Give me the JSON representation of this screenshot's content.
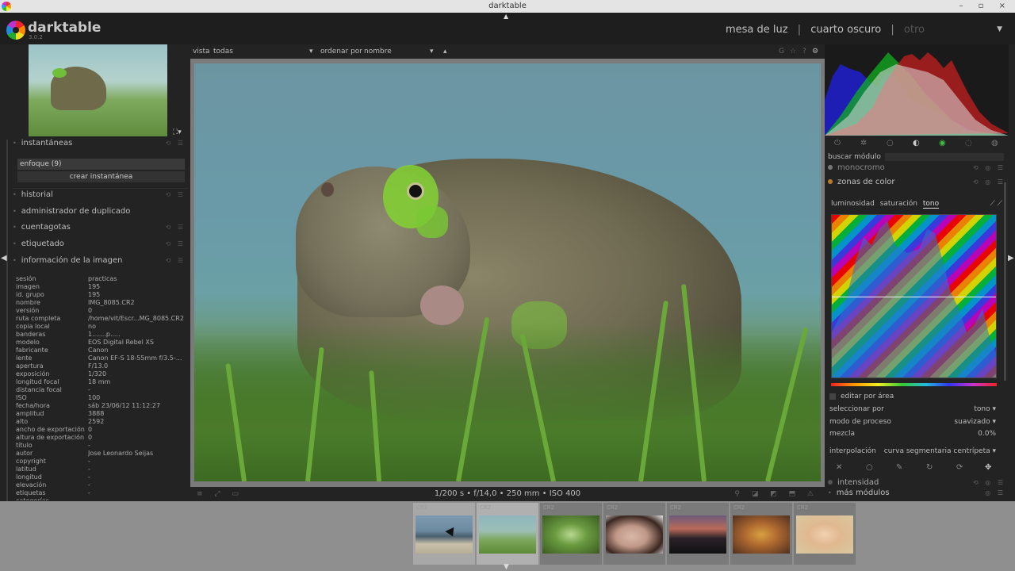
{
  "window": {
    "title": "darktable",
    "controls": "– ▫ ×"
  },
  "header": {
    "logo_text": "darktable",
    "version": "3.0.2",
    "views": [
      "mesa de luz",
      "cuarto oscuro",
      "otro"
    ],
    "separator": "|"
  },
  "toolbar": {
    "view_label": "vista",
    "view_value": "todas",
    "sort_label": "ordenar por",
    "sort_value": "nombre",
    "sort_arrow": "▴"
  },
  "left_panel": {
    "snapshots_title": "instantáneas",
    "snapshot_item": "enfoque (9)",
    "snapshot_button": "crear instantánea",
    "history": "historial",
    "duplicate_manager": "administrador de duplicado",
    "color_picker": "cuentagotas",
    "tagging": "etiquetado",
    "image_info": "información de la imagen",
    "info_rows": [
      {
        "k": "sesión",
        "v": "practicas"
      },
      {
        "k": "imagen",
        "v": "195"
      },
      {
        "k": "id. grupo",
        "v": "195"
      },
      {
        "k": "nombre",
        "v": "IMG_8085.CR2"
      },
      {
        "k": "versión",
        "v": "0"
      },
      {
        "k": "ruta completa",
        "v": "/home/vit/Escr...MG_8085.CR2"
      },
      {
        "k": "copia local",
        "v": "no"
      },
      {
        "k": "banderas",
        "v": "1.......p....."
      },
      {
        "k": "modelo",
        "v": "EOS Digital Rebel XS"
      },
      {
        "k": "fabricante",
        "v": "Canon"
      },
      {
        "k": "lente",
        "v": "Canon EF-S 18-55mm f/3.5-..."
      },
      {
        "k": "apertura",
        "v": "F/13.0"
      },
      {
        "k": "exposición",
        "v": "1/320"
      },
      {
        "k": "longitud focal",
        "v": "18 mm"
      },
      {
        "k": "distancia focal",
        "v": "-"
      },
      {
        "k": "ISO",
        "v": "100"
      },
      {
        "k": "fecha/hora",
        "v": "sáb 23/06/12 11:12:27"
      },
      {
        "k": "amplitud",
        "v": "3888"
      },
      {
        "k": "alto",
        "v": "2592"
      },
      {
        "k": "ancho de exportación",
        "v": "0"
      },
      {
        "k": "altura de exportación",
        "v": "0"
      },
      {
        "k": "título",
        "v": "-"
      },
      {
        "k": "autor",
        "v": "Jose Leonardo Seijas"
      },
      {
        "k": "copyright",
        "v": "-"
      },
      {
        "k": "latitud",
        "v": "-"
      },
      {
        "k": "longitud",
        "v": "-"
      },
      {
        "k": "elevación",
        "v": "-"
      },
      {
        "k": "etiquetas",
        "v": "-"
      },
      {
        "k": "categorías",
        "v": "-"
      }
    ]
  },
  "center": {
    "status": "1/200 s • f/14,0 • 250 mm • ISO 400"
  },
  "right_panel": {
    "search_label": "buscar módulo",
    "module_monochrome": "monocromo",
    "module_color_zones": "zonas de color",
    "tabs": [
      "luminosidad",
      "saturación",
      "tono"
    ],
    "active_tab": "tono",
    "edit_by_area": "editar por área",
    "params": [
      {
        "label": "seleccionar por",
        "value": "tono ▾"
      },
      {
        "label": "modo de proceso",
        "value": "suavizado ▾"
      },
      {
        "label": "mezcla",
        "value": "0.0%"
      },
      {
        "label": "interpolación",
        "value": "curva segmentaria centrípeta ▾"
      }
    ],
    "module_intensity": "intensidad",
    "more_modules": "más módulos"
  },
  "filmstrip": {
    "labels": [
      "CR2",
      "CR2",
      "CR2",
      "CR2",
      "CR2",
      "CR2",
      "CR2"
    ]
  },
  "colors": {
    "accent_green": "#3fbf3f",
    "panel_bg": "#232323",
    "filmstrip_bg": "#8f8f8f"
  }
}
